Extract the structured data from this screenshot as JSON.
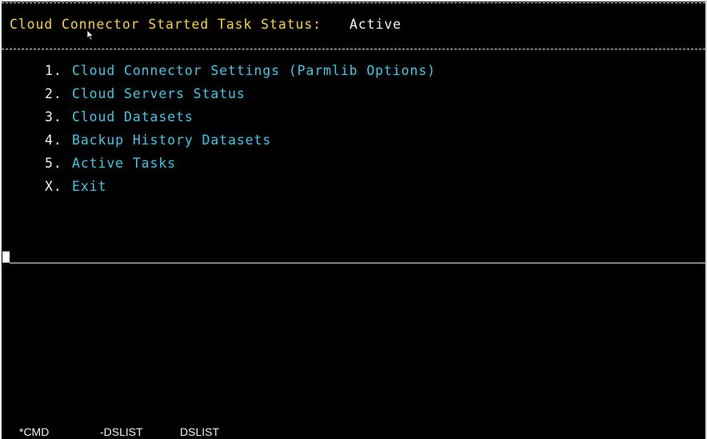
{
  "header": {
    "title": "Cloud Connector Started Task Status:",
    "status_value": "Active"
  },
  "menu": {
    "items": [
      {
        "number": "1.",
        "label": "Cloud Connector Settings (Parmlib Options)"
      },
      {
        "number": "2.",
        "label": "Cloud Servers Status"
      },
      {
        "number": "3.",
        "label": "Cloud Datasets"
      },
      {
        "number": "4.",
        "label": "Backup History Datasets"
      },
      {
        "number": "5.",
        "label": "Active Tasks"
      },
      {
        "number": "X.",
        "label": "Exit"
      }
    ]
  },
  "status_bar": {
    "items": [
      "*CMD",
      "-DSLIST",
      "DSLIST"
    ]
  },
  "colors": {
    "background": "#000000",
    "header_text": "#f5d33b",
    "menu_text": "#3ec6e8",
    "plain_text": "#f2f2f2"
  },
  "icons": {
    "mouse_pointer": "arrow-cursor-icon",
    "text_cursor": "block-cursor-icon"
  }
}
